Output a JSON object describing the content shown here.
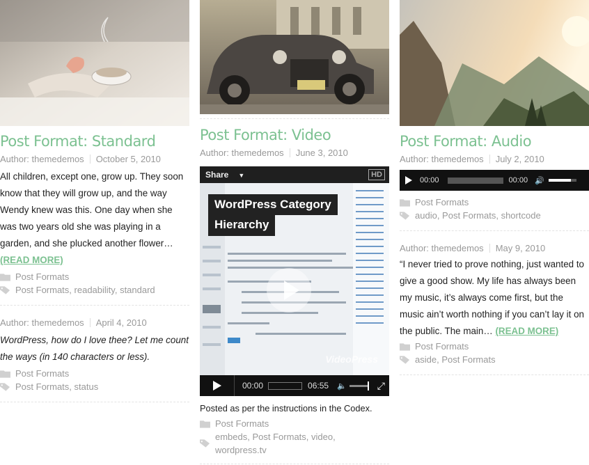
{
  "columns": {
    "left": {
      "post1": {
        "title": "Post Format: Standard",
        "author": "Author: themedemos",
        "date": "October 5, 2010",
        "excerpt": "All children, except one, grow up. They soon know that they will grow up, and the way Wendy knew was this. One day when she was two years old she was playing in a garden, and she plucked another flower…",
        "read_more": "(READ MORE)",
        "category": "Post Formats",
        "tags": [
          "Post Formats",
          "readability",
          "standard"
        ]
      },
      "post2": {
        "author": "Author: themedemos",
        "date": "April 4, 2010",
        "excerpt": "WordPress, how do I love thee? Let me count the ways (in 140 characters or less).",
        "category": "Post Formats",
        "tags": [
          "Post Formats",
          "status"
        ]
      }
    },
    "middle": {
      "post1": {
        "title": "Post Format: Video",
        "author": "Author: themedemos",
        "date": "June 3, 2010",
        "video": {
          "share_label": "Share",
          "hd_label": "HD",
          "caption_line1": "WordPress Category",
          "caption_line2": "Hierarchy",
          "watermark": "VideoPress",
          "current_time": "00:00",
          "duration": "06:55"
        },
        "excerpt": "Posted as per the instructions in the Codex.",
        "category": "Post Formats",
        "tags": [
          "embeds",
          "Post Formats",
          "video",
          "wordpress.tv"
        ]
      }
    },
    "right": {
      "post1": {
        "title": "Post Format: Audio",
        "author": "Author: themedemos",
        "date": "July 2, 2010",
        "audio": {
          "current_time": "00:00",
          "duration": "00:00"
        },
        "category": "Post Formats",
        "tags": [
          "audio",
          "Post Formats",
          "shortcode"
        ]
      },
      "post2": {
        "author": "Author: themedemos",
        "date": "May 9, 2010",
        "excerpt": "“I never tried to prove nothing, just wanted to give a good show. My life has always been my music, it’s always come first, but the music ain’t worth nothing if you can’t lay it on the public. The main…",
        "read_more": "(READ MORE)",
        "category": "Post Formats",
        "tags": [
          "aside",
          "Post Formats"
        ]
      }
    }
  },
  "colors": {
    "accent": "#7cc191",
    "meta": "#999999",
    "divider": "#e3e3e3"
  },
  "icons": {
    "category": "folder-icon",
    "tags": "tag-icon"
  }
}
